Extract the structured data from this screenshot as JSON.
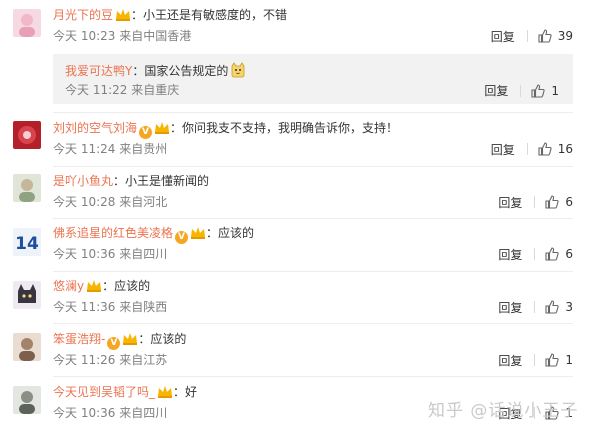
{
  "colors": {
    "username": "#eb7350",
    "meta": "#808080",
    "reply_bg": "#f2f2f2",
    "watermark": "#c9c9c9"
  },
  "comments": [
    {
      "user": "月光下的豆",
      "text": "：小王还是有敏感度的，不错",
      "time": "今天 10:23",
      "source": "来自中国香港",
      "reply_label": "回复",
      "likes": "39",
      "badges": [
        "crown"
      ]
    },
    {
      "user": "刘刘的空气刘海",
      "text": "：你问我支不支持，我明确告诉你，支持！",
      "time": "今天 11:24",
      "source": "来自贵州",
      "reply_label": "回复",
      "likes": "16",
      "badges": [
        "v",
        "crown"
      ]
    },
    {
      "user": "是吖小鱼丸",
      "text": "：小王是懂新闻的",
      "time": "今天 10:28",
      "source": "来自河北",
      "reply_label": "回复",
      "likes": "6",
      "badges": []
    },
    {
      "user": "佛系追星的红色美凌格",
      "text": "：应该的",
      "time": "今天 10:36",
      "source": "来自四川",
      "reply_label": "回复",
      "likes": "6",
      "badges": [
        "v",
        "crown"
      ]
    },
    {
      "user": "悠澜y",
      "text": "：应该的",
      "time": "今天 11:36",
      "source": "来自陕西",
      "reply_label": "回复",
      "likes": "3",
      "badges": [
        "crown"
      ]
    },
    {
      "user": "笨蛋浩翔-",
      "text": "：应该的",
      "time": "今天 11:26",
      "source": "来自江苏",
      "reply_label": "回复",
      "likes": "1",
      "badges": [
        "v",
        "crown"
      ]
    },
    {
      "user": "今天见到吴韬了吗_",
      "text": "：好",
      "time": "今天 10:36",
      "source": "来自四川",
      "reply_label": "回复",
      "likes": "1",
      "badges": [
        "crown"
      ]
    }
  ],
  "nested_reply": {
    "user": "我爱可达鸭Y",
    "text": "：国家公告规定的",
    "emoji": "cat-face-emoji",
    "time": "今天 11:22",
    "source": "来自重庆",
    "reply_label": "回复",
    "likes": "1"
  },
  "watermark": "知乎 @话说小王子"
}
